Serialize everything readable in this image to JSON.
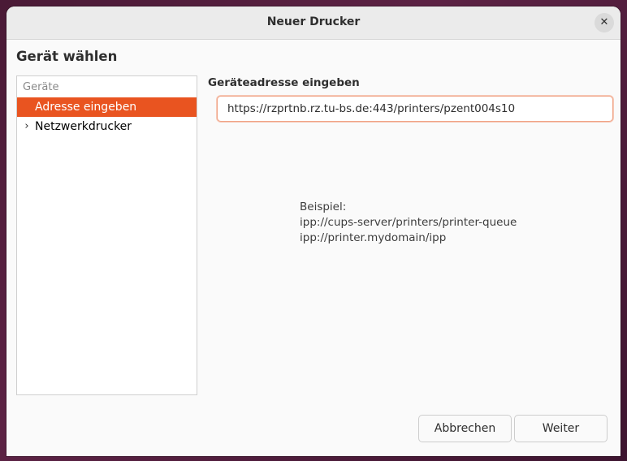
{
  "window": {
    "title": "Neuer Drucker",
    "close_icon": "close-icon"
  },
  "page": {
    "heading": "Gerät wählen"
  },
  "device_list": {
    "header": "Geräte",
    "items": [
      {
        "label": "Adresse eingeben",
        "selected": true,
        "expander": ""
      },
      {
        "label": "Netzwerkdrucker",
        "selected": false,
        "expander": "chevron-right-icon"
      }
    ]
  },
  "address": {
    "label": "Geräteadresse eingeben",
    "value": "https://rzprtnb.rz.tu-bs.de:443/printers/pzent004s10"
  },
  "example": {
    "title": "Beispiel:",
    "lines": [
      "ipp://cups-server/printers/printer-queue",
      "ipp://printer.mydomain/ipp"
    ]
  },
  "buttons": {
    "cancel": "Abbrechen",
    "next": "Weiter"
  },
  "colors": {
    "accent": "#e95420",
    "window_bg": "#fafafa",
    "titlebar_bg": "#ebebeb"
  }
}
